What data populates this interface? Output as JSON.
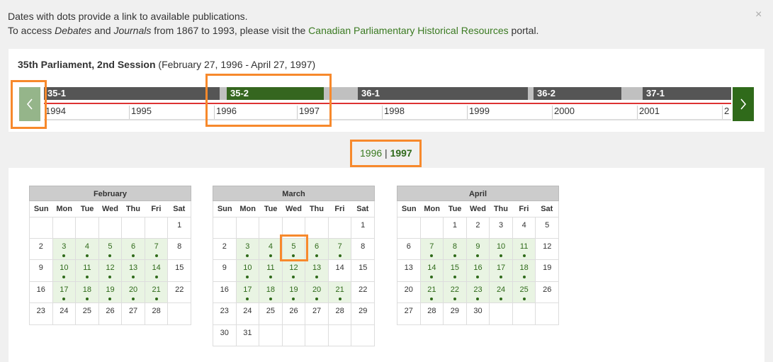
{
  "notice": {
    "line1": "Dates with dots provide a link to available publications.",
    "line2_prefix": "To access ",
    "debates": "Debates",
    "and": " and ",
    "journals": "Journals",
    "line2_mid": " from 1867 to 1993, please visit the ",
    "link": "Canadian Parliamentary Historical Resources",
    "line2_suffix": " portal.",
    "close": "×"
  },
  "session": {
    "title_bold": "35th Parliament, 2nd Session",
    "title_dates": "(February 27, 1996 - April 27, 1997)"
  },
  "timeline": {
    "prev_icon": "chevron-left-icon",
    "next_icon": "chevron-right-icon",
    "segments": [
      "35-1",
      "35-2",
      "36-1",
      "36-2",
      "37-1"
    ],
    "years": [
      "1994",
      "1995",
      "1996",
      "1997",
      "1998",
      "1999",
      "2000",
      "2001",
      "2"
    ]
  },
  "year_switch": {
    "y1996": "1996",
    "sep": " | ",
    "y1997": "1997"
  },
  "weekdays": [
    "Sun",
    "Mon",
    "Tue",
    "Wed",
    "Thu",
    "Fri",
    "Sat"
  ],
  "calendars": [
    {
      "month": "February",
      "lead": 6,
      "days": 28,
      "pub": [
        3,
        4,
        5,
        6,
        7,
        10,
        11,
        12,
        13,
        14,
        17,
        18,
        19,
        20,
        21
      ]
    },
    {
      "month": "March",
      "lead": 6,
      "days": 31,
      "pub": [
        3,
        4,
        5,
        6,
        7,
        10,
        11,
        12,
        13,
        17,
        18,
        19,
        20,
        21
      ]
    },
    {
      "month": "April",
      "lead": 2,
      "days": 30,
      "pub": [
        7,
        8,
        9,
        10,
        11,
        14,
        15,
        16,
        17,
        18,
        21,
        22,
        23,
        24,
        25
      ]
    }
  ]
}
